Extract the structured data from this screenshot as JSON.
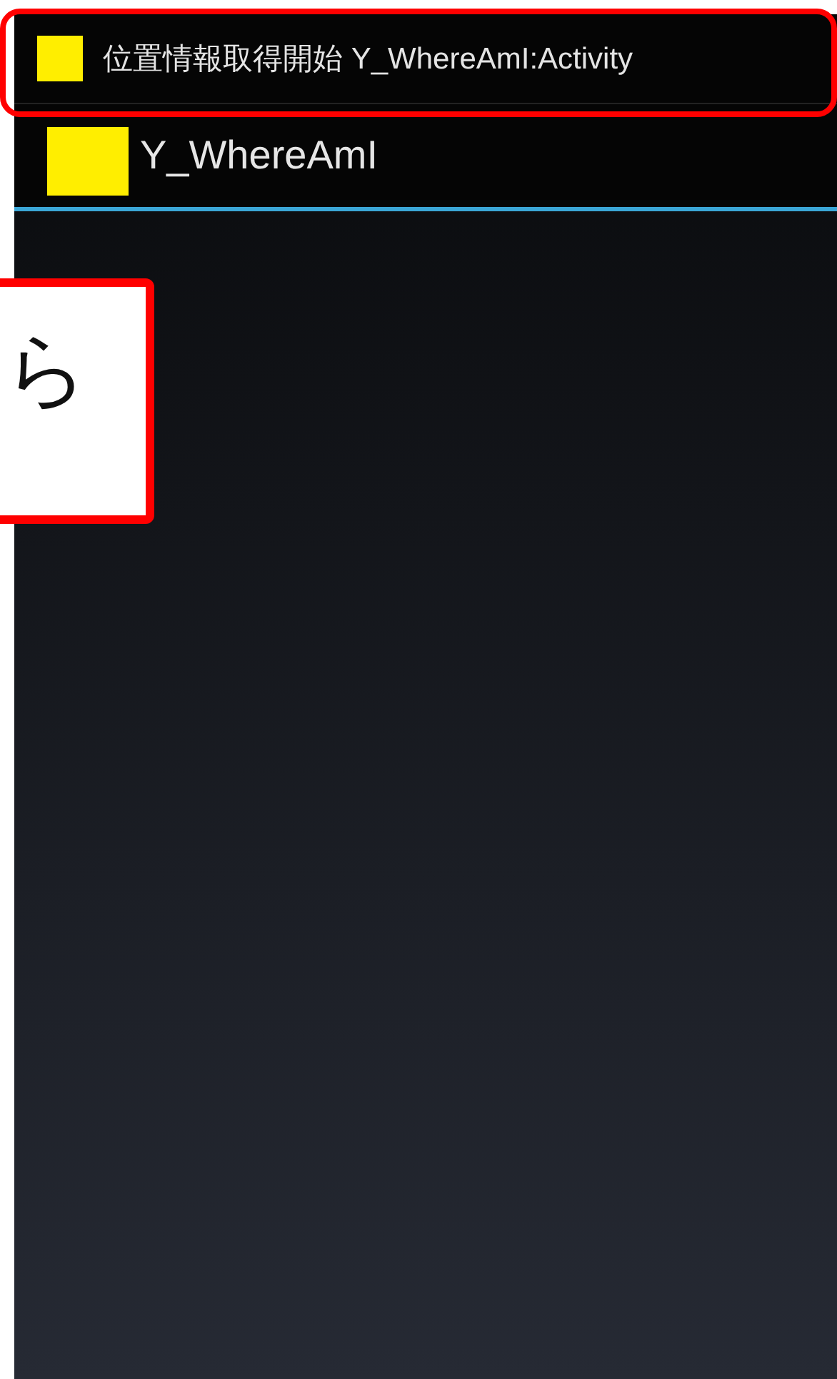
{
  "notification": {
    "text": "位置情報取得開始 Y_WhereAmI:Activity"
  },
  "action_bar": {
    "title": "Y_WhereAmI"
  },
  "callout": {
    "text": "ら"
  }
}
